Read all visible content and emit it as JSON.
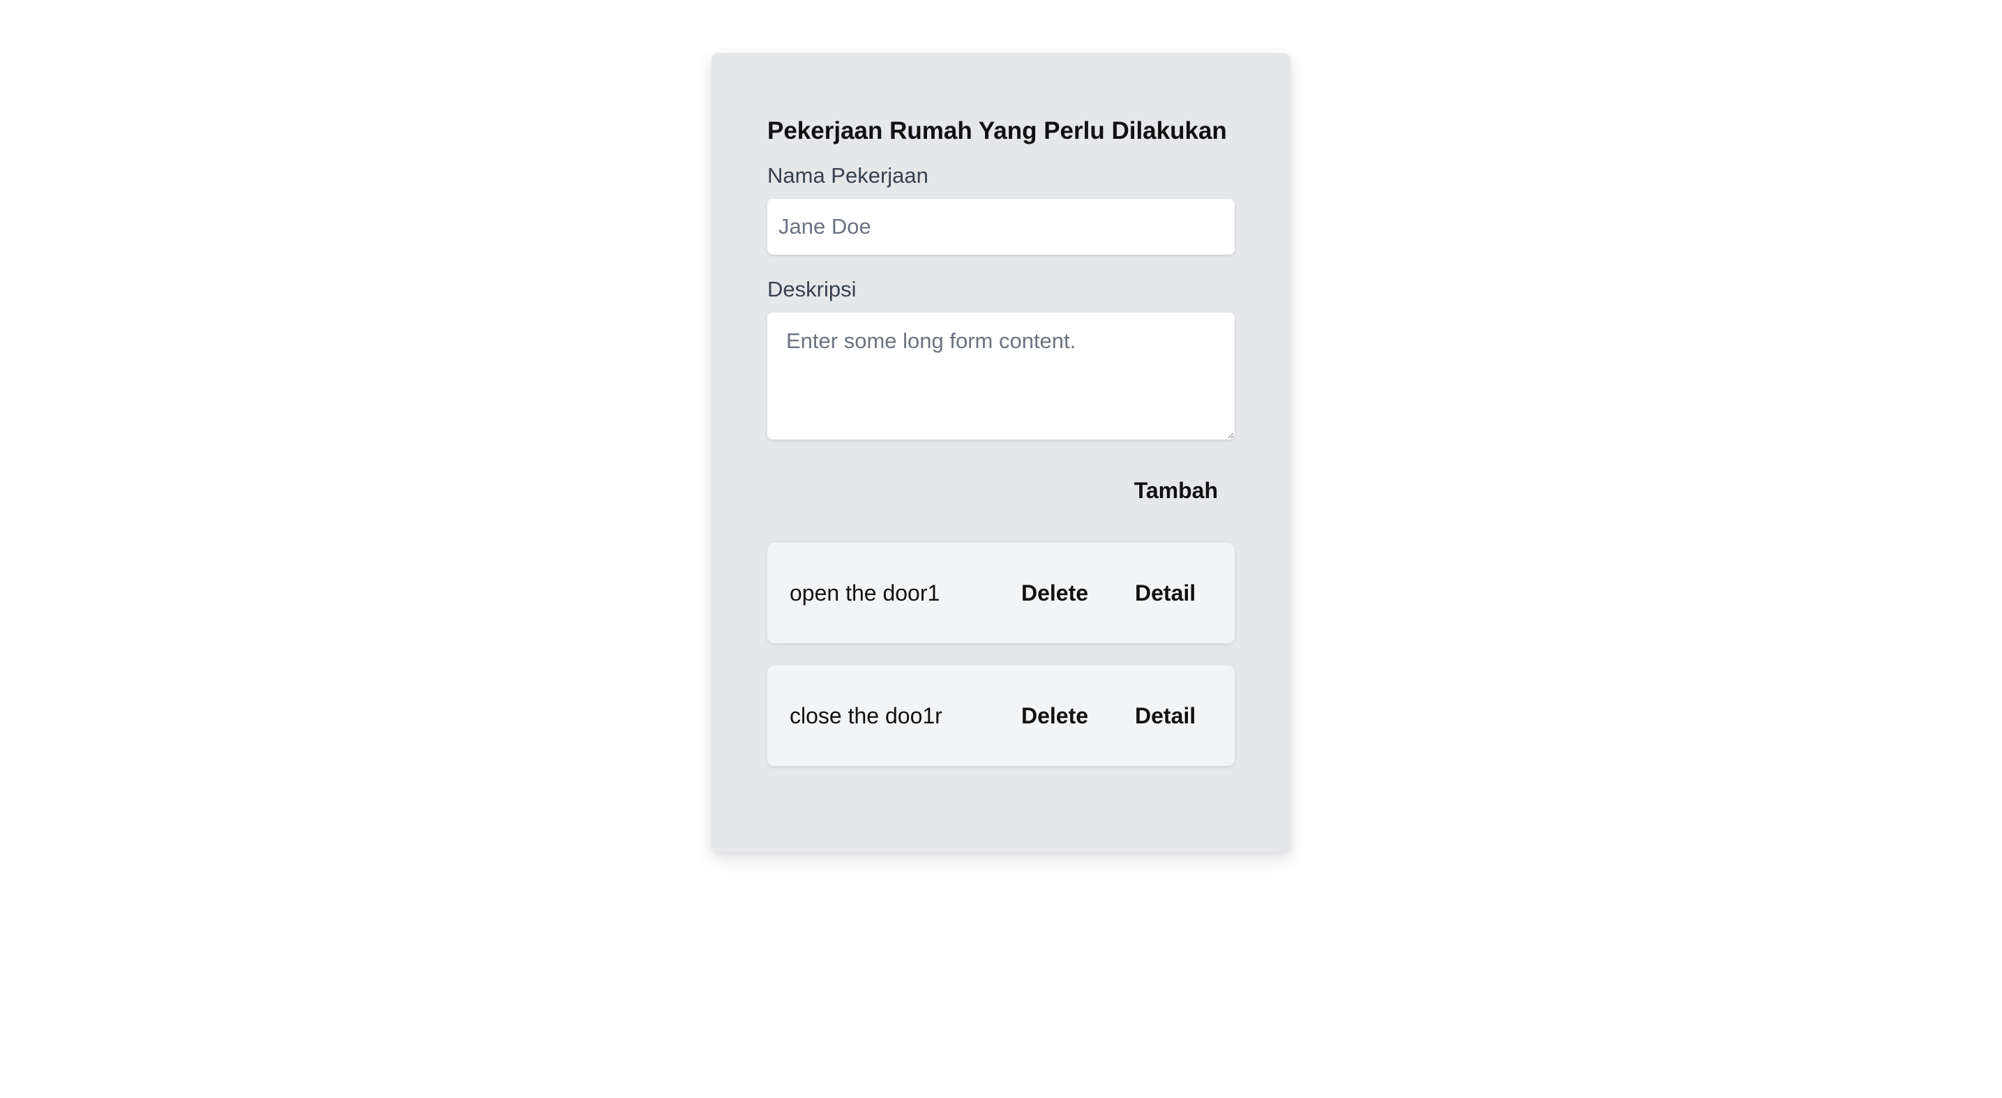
{
  "form": {
    "title": "Pekerjaan Rumah Yang Perlu Dilakukan",
    "name_label": "Nama Pekerjaan",
    "name_placeholder": "Jane Doe",
    "name_value": "",
    "description_label": "Deskripsi",
    "description_placeholder": "Enter some long form content.",
    "description_value": "",
    "add_button_label": "Tambah"
  },
  "tasks": [
    {
      "name": "open the door1",
      "delete_label": "Delete",
      "detail_label": "Detail"
    },
    {
      "name": "close the doo1r",
      "delete_label": "Delete",
      "detail_label": "Detail"
    }
  ],
  "colors": {
    "card_background": "#e5e7eb",
    "task_background": "#f3f4f6",
    "input_background": "#ffffff",
    "label_text": "#374151",
    "placeholder_text": "#6b7280"
  }
}
